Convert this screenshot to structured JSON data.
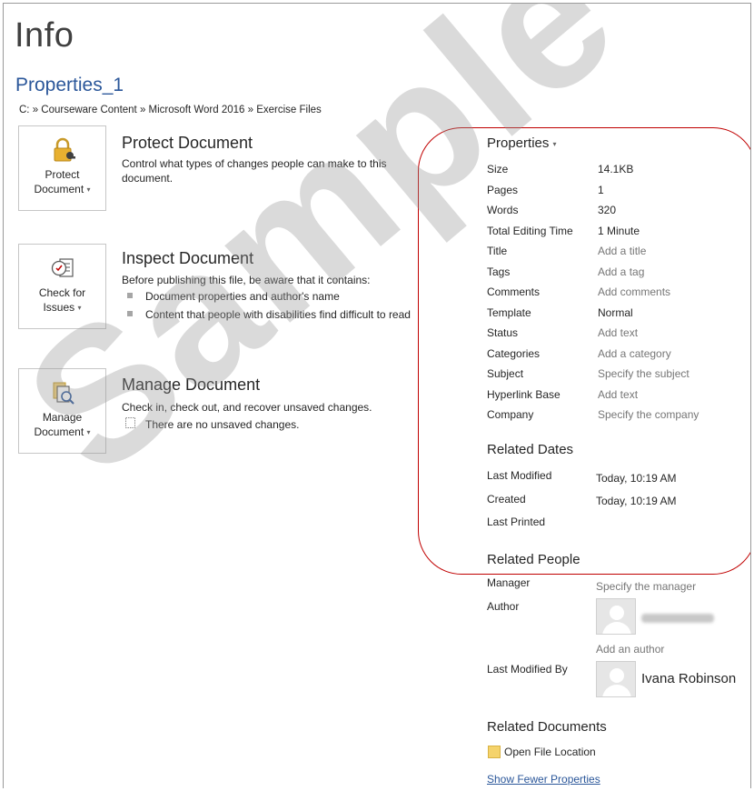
{
  "header": {
    "title": "Info",
    "doc_name": "Properties_1",
    "path": "C: » Courseware Content » Microsoft Word 2016 » Exercise Files"
  },
  "protect": {
    "button_line1": "Protect",
    "button_line2": "Document",
    "title": "Protect Document",
    "desc": "Control what types of changes people can make to this document."
  },
  "inspect": {
    "button_line1": "Check for",
    "button_line2": "Issues",
    "title": "Inspect Document",
    "desc": "Before publishing this file, be aware that it contains:",
    "items": [
      "Document properties and author's name",
      "Content that people with disabilities find difficult to read"
    ]
  },
  "manage": {
    "button_line1": "Manage",
    "button_line2": "Document",
    "title": "Manage Document",
    "desc": "Check in, check out, and recover unsaved changes.",
    "note": "There are no unsaved changes."
  },
  "properties": {
    "heading": "Properties",
    "rows": [
      {
        "label": "Size",
        "value": "14.1KB"
      },
      {
        "label": "Pages",
        "value": "1"
      },
      {
        "label": "Words",
        "value": "320"
      },
      {
        "label": "Total Editing Time",
        "value": "1 Minute"
      },
      {
        "label": "Title",
        "value": "Add a title"
      },
      {
        "label": "Tags",
        "value": "Add a tag"
      },
      {
        "label": "Comments",
        "value": "Add comments"
      },
      {
        "label": "Template",
        "value": "Normal"
      },
      {
        "label": "Status",
        "value": "Add text"
      },
      {
        "label": "Categories",
        "value": "Add a category"
      },
      {
        "label": "Subject",
        "value": "Specify the subject"
      },
      {
        "label": "Hyperlink Base",
        "value": "Add text"
      },
      {
        "label": "Company",
        "value": "Specify the company"
      }
    ]
  },
  "related_dates": {
    "heading": "Related Dates",
    "rows": [
      {
        "label": "Last Modified",
        "value": "Today, 10:19 AM"
      },
      {
        "label": "Created",
        "value": "Today, 10:19 AM"
      },
      {
        "label": "Last Printed",
        "value": ""
      }
    ]
  },
  "related_people": {
    "heading": "Related People",
    "manager_label": "Manager",
    "manager_value": "Specify the manager",
    "author_label": "Author",
    "add_author": "Add an author",
    "last_modified_by_label": "Last Modified By",
    "last_modified_by_value": "Ivana Robinson"
  },
  "related_documents": {
    "heading": "Related Documents",
    "open_location": "Open File Location",
    "show_fewer": "Show Fewer Properties"
  },
  "watermark": "Sample"
}
